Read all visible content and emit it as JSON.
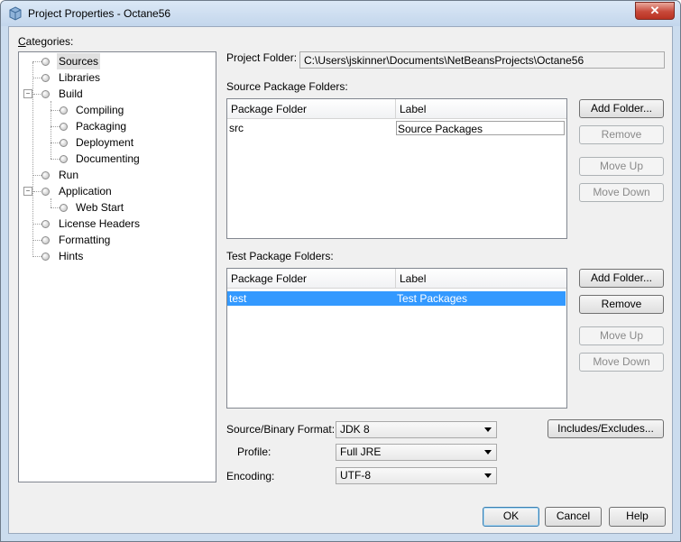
{
  "window": {
    "title": "Project Properties - Octane56",
    "close_glyph": "✕"
  },
  "categories": {
    "label": "Categories:",
    "items": [
      {
        "label": "Sources",
        "selected": true
      },
      {
        "label": "Libraries"
      },
      {
        "label": "Build",
        "expanded": true,
        "children": [
          {
            "label": "Compiling"
          },
          {
            "label": "Packaging"
          },
          {
            "label": "Deployment"
          },
          {
            "label": "Documenting"
          }
        ]
      },
      {
        "label": "Run"
      },
      {
        "label": "Application",
        "expanded": true,
        "children": [
          {
            "label": "Web Start"
          }
        ]
      },
      {
        "label": "License Headers"
      },
      {
        "label": "Formatting"
      },
      {
        "label": "Hints"
      }
    ]
  },
  "project_folder": {
    "label": "Project Folder:",
    "value": "C:\\Users\\jskinner\\Documents\\NetBeansProjects\\Octane56"
  },
  "source_packages": {
    "label": "Source Package Folders:",
    "columns": [
      "Package Folder",
      "Label"
    ],
    "rows": [
      {
        "folder": "src",
        "label": "Source Packages"
      }
    ],
    "buttons": {
      "add": "Add Folder...",
      "remove": "Remove",
      "move_up": "Move Up",
      "move_down": "Move Down"
    }
  },
  "test_packages": {
    "label": "Test Package Folders:",
    "columns": [
      "Package Folder",
      "Label"
    ],
    "rows": [
      {
        "folder": "test",
        "label": "Test Packages",
        "selected": true
      }
    ],
    "buttons": {
      "add": "Add Folder...",
      "remove": "Remove",
      "move_up": "Move Up",
      "move_down": "Move Down"
    }
  },
  "format": {
    "source_binary_label": "Source/Binary Format:",
    "source_binary_value": "JDK 8",
    "profile_label": "Profile:",
    "profile_value": "Full JRE",
    "encoding_label": "Encoding:",
    "encoding_value": "UTF-8",
    "includes_button": "Includes/Excludes..."
  },
  "footer": {
    "ok": "OK",
    "cancel": "Cancel",
    "help": "Help"
  },
  "colors": {
    "selection": "#3399ff",
    "title_bar": "#c3d6ec",
    "close_button": "#c8493a"
  }
}
